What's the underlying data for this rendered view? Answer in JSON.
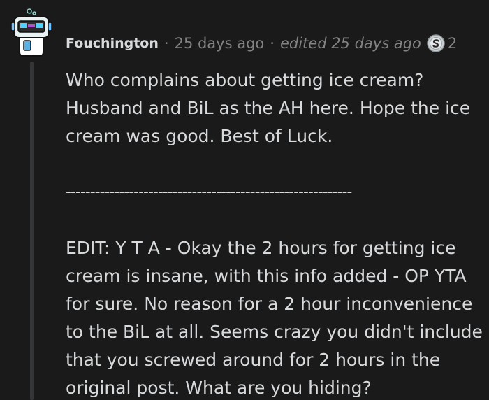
{
  "comment": {
    "author": "Fouchington",
    "separator": "·",
    "timestamp": "25 days ago",
    "edited": "edited 25 days ago",
    "award_icon": "silver-award-icon",
    "award_count": "2",
    "paragraphs": [
      "Who complains about getting ice cream? Husband and BiL as the AH here. Hope the ice cream was good. Best of Luck.",
      "-----------------------------------------------------------",
      "EDIT: Y T A - Okay the 2 hours for getting ice cream is insane, with this info added - OP YTA for sure. No reason for a 2 hour inconvenience to the BiL at all. Seems crazy you didn't include that you screwed around for 2 hours in the original post. What are you hiding?"
    ]
  },
  "colors": {
    "background": "#1a1a1b",
    "text": "#d7dadc",
    "meta": "#818384",
    "thread_line": "#343536"
  }
}
